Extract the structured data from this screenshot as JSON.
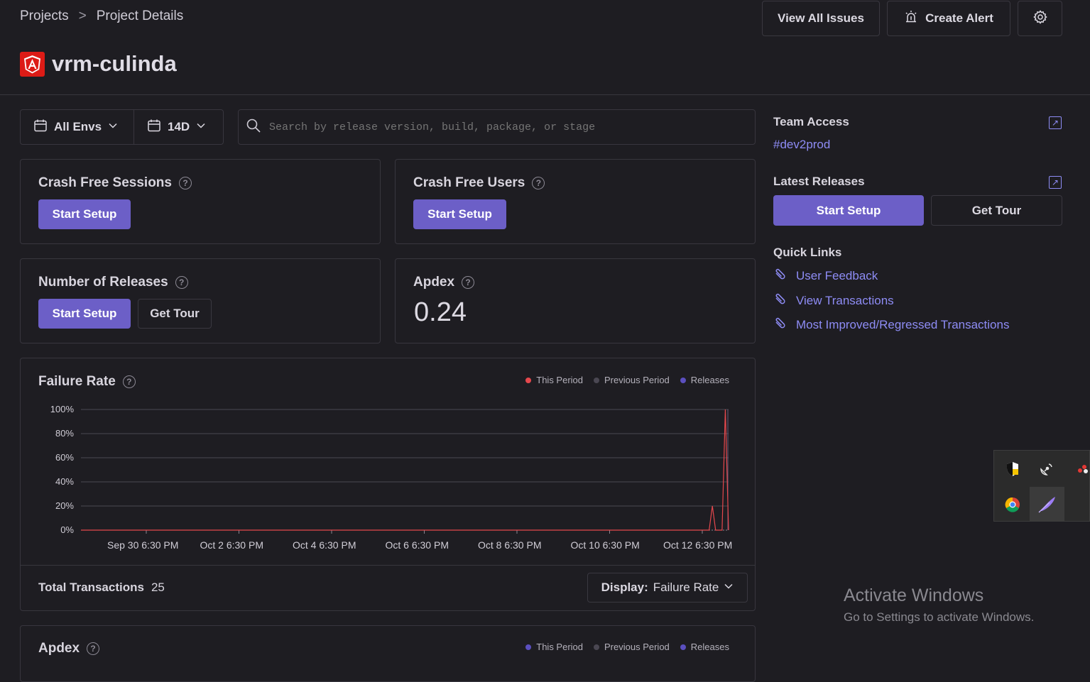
{
  "breadcrumb": {
    "root": "Projects",
    "separator": ">",
    "current": "Project Details"
  },
  "project": {
    "name": "vrm-culinda",
    "platform_icon": "angular-icon"
  },
  "header_actions": {
    "view_all_issues": "View All Issues",
    "create_alert": "Create Alert",
    "settings_icon": "gear-icon"
  },
  "filters": {
    "env": "All Envs",
    "period": "14D",
    "search_placeholder": "Search by release version, build, package, or stage"
  },
  "cards": {
    "crash_free_sessions": {
      "title": "Crash Free Sessions",
      "button": "Start Setup"
    },
    "crash_free_users": {
      "title": "Crash Free Users",
      "button": "Start Setup"
    },
    "number_of_releases": {
      "title": "Number of Releases",
      "primary": "Start Setup",
      "secondary": "Get Tour"
    },
    "apdex": {
      "title": "Apdex",
      "value": "0.24"
    }
  },
  "failure_rate": {
    "title": "Failure Rate",
    "legend": [
      {
        "label": "This Period",
        "color": "#e5484d"
      },
      {
        "label": "Previous Period",
        "color": "#4a4752"
      },
      {
        "label": "Releases",
        "color": "#5b4fbf"
      }
    ],
    "footer_label": "Total Transactions",
    "footer_value": "25",
    "display_label": "Display:",
    "display_value": "Failure Rate"
  },
  "chart_data": {
    "type": "line",
    "title": "Failure Rate",
    "y_ticks": [
      "100%",
      "80%",
      "60%",
      "40%",
      "20%",
      "0%"
    ],
    "ylim": [
      0,
      100
    ],
    "x_ticks": [
      "Sep 30 6:30 PM",
      "Oct 2 6:30 PM",
      "Oct 4 6:30 PM",
      "Oct 6 6:30 PM",
      "Oct 8 6:30 PM",
      "Oct 10 6:30 PM",
      "Oct 12 6:30 PM"
    ],
    "series": [
      {
        "name": "This Period",
        "points": [
          {
            "x": 0,
            "y": 0
          },
          {
            "x": 0.97,
            "y": 0
          },
          {
            "x": 0.975,
            "y": 20
          },
          {
            "x": 0.98,
            "y": 0
          },
          {
            "x": 0.99,
            "y": 0
          },
          {
            "x": 0.995,
            "y": 100
          },
          {
            "x": 1,
            "y": 0
          }
        ]
      }
    ]
  },
  "apdex_chart": {
    "title": "Apdex",
    "legend": [
      {
        "label": "This Period",
        "color": "#5b4fbf"
      },
      {
        "label": "Previous Period",
        "color": "#4a4752"
      },
      {
        "label": "Releases",
        "color": "#5b4fbf"
      }
    ]
  },
  "sidebar": {
    "team_access_title": "Team Access",
    "team": "#dev2prod",
    "latest_releases_title": "Latest Releases",
    "start_setup": "Start Setup",
    "get_tour": "Get Tour",
    "quick_links_title": "Quick Links",
    "quick_links": [
      "User Feedback",
      "View Transactions",
      "Most Improved/Regressed Transactions"
    ]
  },
  "watermark": {
    "title": "Activate Windows",
    "subtitle": "Go to Settings to activate Windows."
  }
}
